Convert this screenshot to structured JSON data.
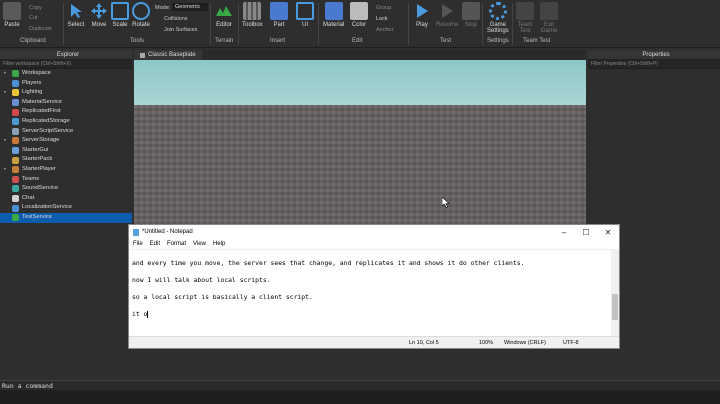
{
  "ribbon": {
    "clipboard": {
      "paste": "Paste",
      "copy": "Copy",
      "cut": "Cut",
      "duplicate": "Duplicate",
      "group": "Clipboard"
    },
    "tools": {
      "select": "Select",
      "move": "Move",
      "scale": "Scale",
      "rotate": "Rotate",
      "group": "Tools",
      "mode_label": "Mode:",
      "mode_value": "Geometric",
      "collisions": "Collisions",
      "join_surfaces": "Join Surfaces"
    },
    "terrain": {
      "editor": "Editor",
      "group": "Terrain"
    },
    "insert": {
      "toolbox": "Toolbox",
      "part": "Part",
      "ui": "UI",
      "group": "Insert"
    },
    "edit": {
      "material": "Material",
      "color": "Color",
      "group_btn": "Group",
      "lock": "Lock",
      "anchor": "Anchor",
      "group": "Edit"
    },
    "test": {
      "play": "Play",
      "resume": "Resume",
      "stop": "Stop",
      "group": "Test"
    },
    "settings": {
      "game_settings_1": "Game",
      "game_settings_2": "Settings",
      "group": "Settings"
    },
    "team_test": {
      "team": "Team",
      "test": "Test",
      "exit": "Exit",
      "game": "Game",
      "group": "Team Test"
    }
  },
  "explorer": {
    "title": "Explorer",
    "filter": "Filter workspace (Ctrl+Shift+X)",
    "items": [
      {
        "label": "Workspace",
        "icon": "workspace-icon",
        "color": "#3aa845",
        "arrow": true
      },
      {
        "label": "Players",
        "icon": "players-icon",
        "color": "#4a8fd8",
        "arrow": false
      },
      {
        "label": "Lighting",
        "icon": "lighting-icon",
        "color": "#e8c53a",
        "arrow": true
      },
      {
        "label": "MaterialService",
        "icon": "material-service-icon",
        "color": "#6a8fd0",
        "arrow": false
      },
      {
        "label": "ReplicatedFirst",
        "icon": "replicated-first-icon",
        "color": "#d04a4a",
        "arrow": false
      },
      {
        "label": "ReplicatedStorage",
        "icon": "replicated-storage-icon",
        "color": "#4a9ad0",
        "arrow": false
      },
      {
        "label": "ServerScriptService",
        "icon": "server-script-service-icon",
        "color": "#8aa0b8",
        "arrow": false
      },
      {
        "label": "ServerStorage",
        "icon": "server-storage-icon",
        "color": "#c97a3a",
        "arrow": true
      },
      {
        "label": "StarterGui",
        "icon": "starter-gui-icon",
        "color": "#6aa0d8",
        "arrow": false
      },
      {
        "label": "StarterPack",
        "icon": "starter-pack-icon",
        "color": "#c9a040",
        "arrow": false
      },
      {
        "label": "StarterPlayer",
        "icon": "starter-player-icon",
        "color": "#c0803a",
        "arrow": true
      },
      {
        "label": "Teams",
        "icon": "teams-icon",
        "color": "#d05050",
        "arrow": false
      },
      {
        "label": "SoundService",
        "icon": "sound-service-icon",
        "color": "#3aa8a0",
        "arrow": false
      },
      {
        "label": "Chat",
        "icon": "chat-icon",
        "color": "#d0d0d0",
        "arrow": false
      },
      {
        "label": "LocalizationService",
        "icon": "localization-service-icon",
        "color": "#4a8fd8",
        "arrow": false
      },
      {
        "label": "TestService",
        "icon": "test-service-icon",
        "color": "#3aa845",
        "arrow": false,
        "selected": true
      }
    ]
  },
  "properties": {
    "title": "Properties",
    "filter": "Filter Properties (Ctrl+Shift+P)"
  },
  "viewport": {
    "tab_label": "Classic Baseplate"
  },
  "notepad": {
    "title": "*Untitled - Notepad",
    "menu": [
      "File",
      "Edit",
      "Format",
      "View",
      "Help"
    ],
    "lines": [
      "and every time you move, the server sees that change, and replicates it and shows it do other clients.",
      "now I will talk about local scripts.",
      "so a local script is basically a client script.",
      "it o"
    ],
    "status": {
      "position": "Ln 10, Col 5",
      "zoom": "100%",
      "line_ending": "Windows (CRLF)",
      "encoding": "UTF-8"
    }
  },
  "command_bar": {
    "placeholder": "Run a command"
  }
}
